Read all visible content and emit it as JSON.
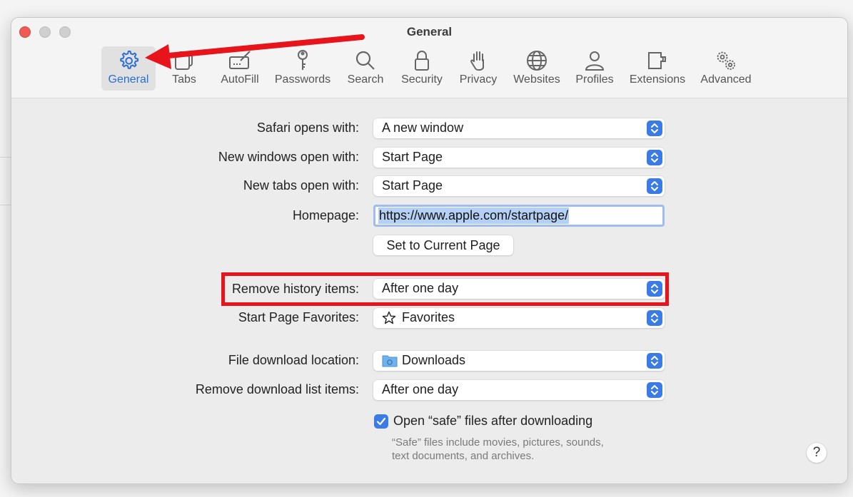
{
  "window": {
    "title": "General"
  },
  "toolbar": {
    "items": [
      {
        "label": "General",
        "icon": "gear-icon",
        "active": true
      },
      {
        "label": "Tabs",
        "icon": "tabs-icon"
      },
      {
        "label": "AutoFill",
        "icon": "autofill-icon"
      },
      {
        "label": "Passwords",
        "icon": "key-icon"
      },
      {
        "label": "Search",
        "icon": "search-icon"
      },
      {
        "label": "Security",
        "icon": "lock-icon"
      },
      {
        "label": "Privacy",
        "icon": "hand-icon"
      },
      {
        "label": "Websites",
        "icon": "globe-icon"
      },
      {
        "label": "Profiles",
        "icon": "person-icon"
      },
      {
        "label": "Extensions",
        "icon": "puzzle-icon"
      },
      {
        "label": "Advanced",
        "icon": "gears-icon"
      }
    ]
  },
  "settings": {
    "safari_opens_with": {
      "label": "Safari opens with:",
      "value": "A new window"
    },
    "new_windows_open_with": {
      "label": "New windows open with:",
      "value": "Start Page"
    },
    "new_tabs_open_with": {
      "label": "New tabs open with:",
      "value": "Start Page"
    },
    "homepage": {
      "label": "Homepage:",
      "value": "https://www.apple.com/startpage/"
    },
    "set_current_page": {
      "label": "Set to Current Page"
    },
    "remove_history_items": {
      "label": "Remove history items:",
      "value": "After one day"
    },
    "start_page_favorites": {
      "label": "Start Page Favorites:",
      "value": "Favorites"
    },
    "file_download_location": {
      "label": "File download location:",
      "value": "Downloads"
    },
    "remove_download_list_items": {
      "label": "Remove download list items:",
      "value": "After one day"
    },
    "open_safe_files": {
      "label": "Open “safe” files after downloading",
      "checked": true
    },
    "safe_files_hint_line1": "“Safe” files include movies, pictures, sounds,",
    "safe_files_hint_line2": "text documents, and archives."
  },
  "help": {
    "label": "?"
  },
  "colors": {
    "accent": "#3b7be6",
    "annotation_red": "#e8141b",
    "active_tab_text": "#2a6fd3",
    "close_button": "#ee5b57"
  }
}
